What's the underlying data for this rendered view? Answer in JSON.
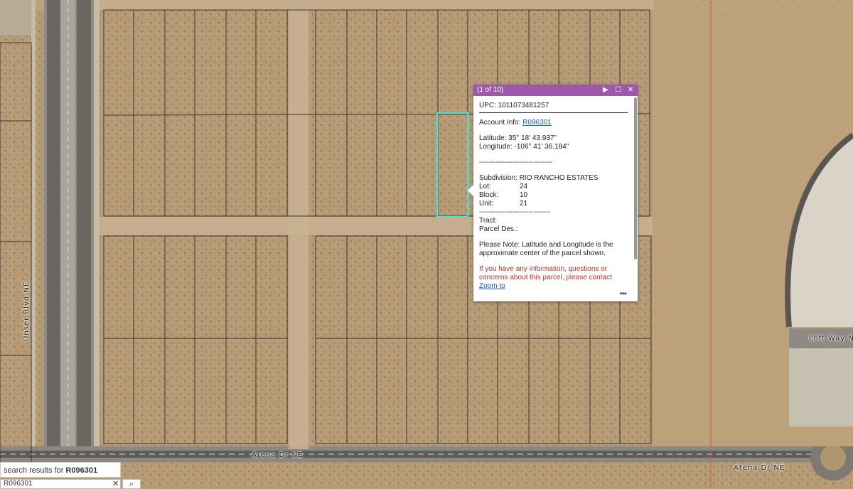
{
  "map": {
    "roads": {
      "unser": "Unser Blvd NE",
      "arena_left": "Arena Dr NE",
      "arena_right": "Arena Dr NE",
      "loft": "Loft Way N"
    }
  },
  "popup": {
    "count_label": "(1 of 10)",
    "upc": "UPC: 1011073481257",
    "account_label": "Account Info: ",
    "account_link": "R096301",
    "latitude": "Latitude: 35° 18' 43.937\"",
    "longitude": "Longitude: -106° 41' 36.184\"",
    "separator": "-------------------------------",
    "subdivision": "Subdivision: RIO RANCHO ESTATES",
    "lot_label": "Lot:",
    "lot_value": "24",
    "block_label": "Block:",
    "block_value": "10",
    "unit_label": "Unit:",
    "unit_value": "21",
    "separator2": "------------------------------",
    "tract": "Tract:",
    "parcel_des": "Parcel Des.:",
    "note_line1": "Please Note: Latitude and Longitude is the",
    "note_line2": "approximate center of the parcel shown.",
    "red_line1": "If you have any information, questions or",
    "red_line2": "concerns about this parcel, please contact",
    "zoom_link": "Zoom to",
    "more": "•••"
  },
  "search": {
    "result_prefix": "search results for ",
    "result_term": "R096301",
    "input_value": "R096301",
    "clear_icon": "✕",
    "search_icon": "⌕"
  },
  "colors": {
    "popup_header": "#9e5aa8",
    "parcel_highlight": "#54e0d8",
    "terrain": "#b69a76"
  }
}
